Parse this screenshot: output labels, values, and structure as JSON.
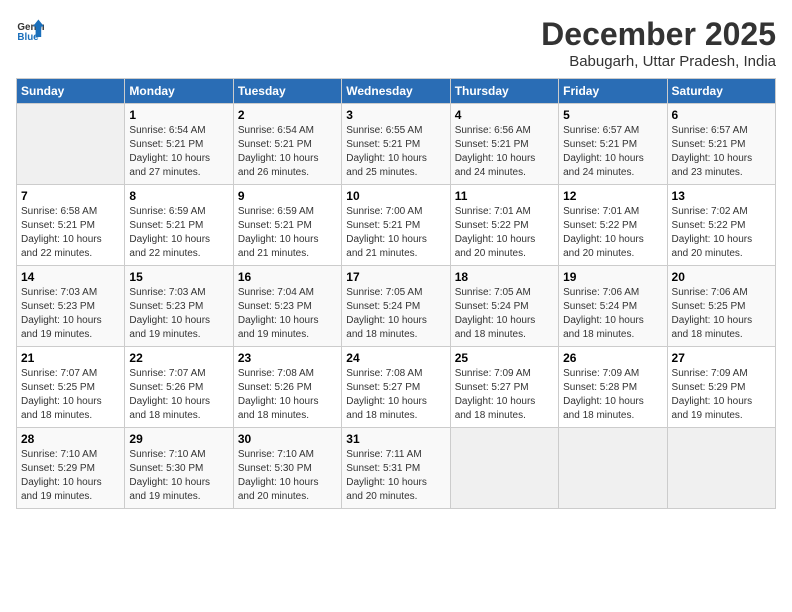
{
  "header": {
    "logo_general": "General",
    "logo_blue": "Blue",
    "title": "December 2025",
    "subtitle": "Babugarh, Uttar Pradesh, India"
  },
  "calendar": {
    "days_of_week": [
      "Sunday",
      "Monday",
      "Tuesday",
      "Wednesday",
      "Thursday",
      "Friday",
      "Saturday"
    ],
    "weeks": [
      [
        {
          "day": "",
          "info": ""
        },
        {
          "day": "1",
          "info": "Sunrise: 6:54 AM\nSunset: 5:21 PM\nDaylight: 10 hours\nand 27 minutes."
        },
        {
          "day": "2",
          "info": "Sunrise: 6:54 AM\nSunset: 5:21 PM\nDaylight: 10 hours\nand 26 minutes."
        },
        {
          "day": "3",
          "info": "Sunrise: 6:55 AM\nSunset: 5:21 PM\nDaylight: 10 hours\nand 25 minutes."
        },
        {
          "day": "4",
          "info": "Sunrise: 6:56 AM\nSunset: 5:21 PM\nDaylight: 10 hours\nand 24 minutes."
        },
        {
          "day": "5",
          "info": "Sunrise: 6:57 AM\nSunset: 5:21 PM\nDaylight: 10 hours\nand 24 minutes."
        },
        {
          "day": "6",
          "info": "Sunrise: 6:57 AM\nSunset: 5:21 PM\nDaylight: 10 hours\nand 23 minutes."
        }
      ],
      [
        {
          "day": "7",
          "info": "Sunrise: 6:58 AM\nSunset: 5:21 PM\nDaylight: 10 hours\nand 22 minutes."
        },
        {
          "day": "8",
          "info": "Sunrise: 6:59 AM\nSunset: 5:21 PM\nDaylight: 10 hours\nand 22 minutes."
        },
        {
          "day": "9",
          "info": "Sunrise: 6:59 AM\nSunset: 5:21 PM\nDaylight: 10 hours\nand 21 minutes."
        },
        {
          "day": "10",
          "info": "Sunrise: 7:00 AM\nSunset: 5:21 PM\nDaylight: 10 hours\nand 21 minutes."
        },
        {
          "day": "11",
          "info": "Sunrise: 7:01 AM\nSunset: 5:22 PM\nDaylight: 10 hours\nand 20 minutes."
        },
        {
          "day": "12",
          "info": "Sunrise: 7:01 AM\nSunset: 5:22 PM\nDaylight: 10 hours\nand 20 minutes."
        },
        {
          "day": "13",
          "info": "Sunrise: 7:02 AM\nSunset: 5:22 PM\nDaylight: 10 hours\nand 20 minutes."
        }
      ],
      [
        {
          "day": "14",
          "info": "Sunrise: 7:03 AM\nSunset: 5:23 PM\nDaylight: 10 hours\nand 19 minutes."
        },
        {
          "day": "15",
          "info": "Sunrise: 7:03 AM\nSunset: 5:23 PM\nDaylight: 10 hours\nand 19 minutes."
        },
        {
          "day": "16",
          "info": "Sunrise: 7:04 AM\nSunset: 5:23 PM\nDaylight: 10 hours\nand 19 minutes."
        },
        {
          "day": "17",
          "info": "Sunrise: 7:05 AM\nSunset: 5:24 PM\nDaylight: 10 hours\nand 18 minutes."
        },
        {
          "day": "18",
          "info": "Sunrise: 7:05 AM\nSunset: 5:24 PM\nDaylight: 10 hours\nand 18 minutes."
        },
        {
          "day": "19",
          "info": "Sunrise: 7:06 AM\nSunset: 5:24 PM\nDaylight: 10 hours\nand 18 minutes."
        },
        {
          "day": "20",
          "info": "Sunrise: 7:06 AM\nSunset: 5:25 PM\nDaylight: 10 hours\nand 18 minutes."
        }
      ],
      [
        {
          "day": "21",
          "info": "Sunrise: 7:07 AM\nSunset: 5:25 PM\nDaylight: 10 hours\nand 18 minutes."
        },
        {
          "day": "22",
          "info": "Sunrise: 7:07 AM\nSunset: 5:26 PM\nDaylight: 10 hours\nand 18 minutes."
        },
        {
          "day": "23",
          "info": "Sunrise: 7:08 AM\nSunset: 5:26 PM\nDaylight: 10 hours\nand 18 minutes."
        },
        {
          "day": "24",
          "info": "Sunrise: 7:08 AM\nSunset: 5:27 PM\nDaylight: 10 hours\nand 18 minutes."
        },
        {
          "day": "25",
          "info": "Sunrise: 7:09 AM\nSunset: 5:27 PM\nDaylight: 10 hours\nand 18 minutes."
        },
        {
          "day": "26",
          "info": "Sunrise: 7:09 AM\nSunset: 5:28 PM\nDaylight: 10 hours\nand 18 minutes."
        },
        {
          "day": "27",
          "info": "Sunrise: 7:09 AM\nSunset: 5:29 PM\nDaylight: 10 hours\nand 19 minutes."
        }
      ],
      [
        {
          "day": "28",
          "info": "Sunrise: 7:10 AM\nSunset: 5:29 PM\nDaylight: 10 hours\nand 19 minutes."
        },
        {
          "day": "29",
          "info": "Sunrise: 7:10 AM\nSunset: 5:30 PM\nDaylight: 10 hours\nand 19 minutes."
        },
        {
          "day": "30",
          "info": "Sunrise: 7:10 AM\nSunset: 5:30 PM\nDaylight: 10 hours\nand 20 minutes."
        },
        {
          "day": "31",
          "info": "Sunrise: 7:11 AM\nSunset: 5:31 PM\nDaylight: 10 hours\nand 20 minutes."
        },
        {
          "day": "",
          "info": ""
        },
        {
          "day": "",
          "info": ""
        },
        {
          "day": "",
          "info": ""
        }
      ]
    ]
  }
}
